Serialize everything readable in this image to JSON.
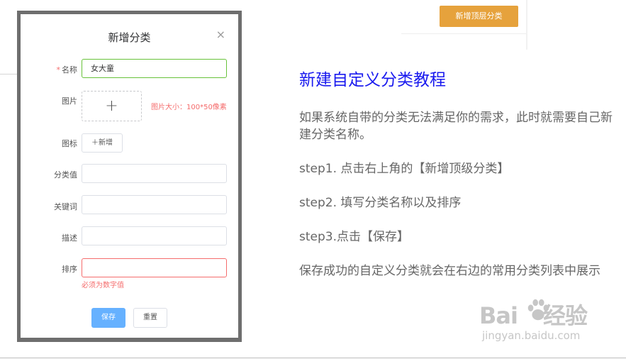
{
  "header": {
    "add_top_category_label": "新增顶层分类"
  },
  "dialog": {
    "title": "新增分类",
    "close_glyph": "×",
    "fields": {
      "name": {
        "required_mark": "*",
        "label": "名称",
        "value": "女大童"
      },
      "image": {
        "label": "图片",
        "upload_glyph": "+",
        "hint": "图片大小：100*50像素"
      },
      "icon": {
        "label": "图标",
        "add_label": "＋新增"
      },
      "category_value": {
        "label": "分类值",
        "value": ""
      },
      "keywords": {
        "label": "关键词",
        "value": ""
      },
      "description": {
        "label": "描述",
        "value": ""
      },
      "sort": {
        "label": "排序",
        "value": "",
        "error": "必须为数字值"
      }
    },
    "buttons": {
      "save": "保存",
      "reset": "重置"
    }
  },
  "tutorial": {
    "title": "新建自定义分类教程",
    "paragraphs": [
      "如果系统自带的分类无法满足你的需求，此时就需要自己新建分类名称。",
      "step1. 点击右上角的【新增顶级分类】",
      "step2. 填写分类名称以及排序",
      "step3.点击【保存】",
      "保存成功的自定义分类就会在右边的常用分类列表中展示"
    ]
  },
  "watermark": {
    "logo_text": "Bai",
    "logo_text2": "经验",
    "url": "jingyan.baidu.com"
  },
  "colors": {
    "primary": "#66b1ff",
    "warning": "#e6a23c",
    "danger": "#f56c6c",
    "success": "#67c23a",
    "title_blue": "#1a1aef"
  }
}
